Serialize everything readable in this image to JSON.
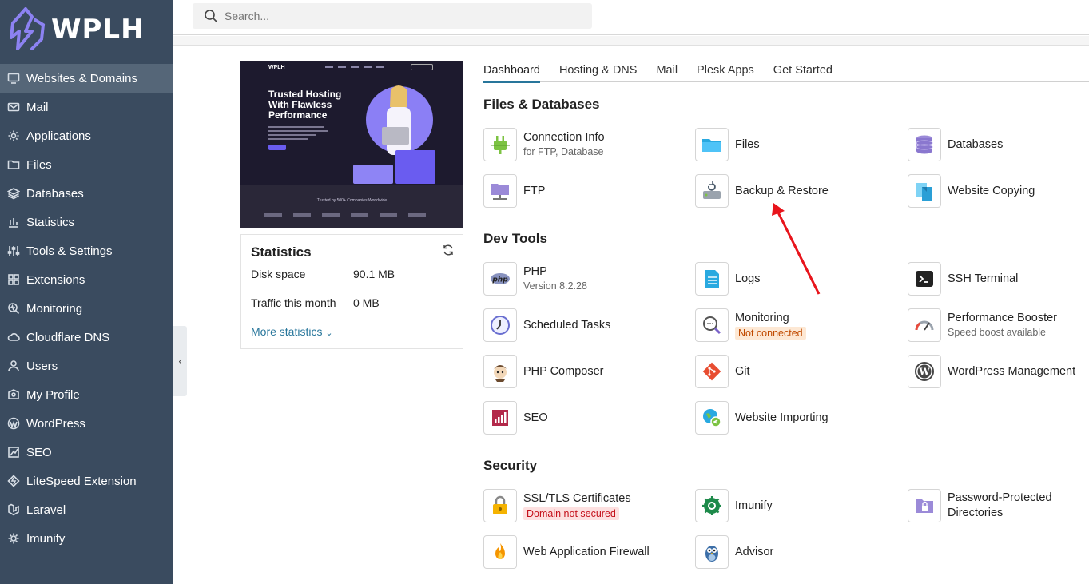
{
  "brand": {
    "logo_text": "WPLH"
  },
  "search": {
    "placeholder": "Search..."
  },
  "sidebar": {
    "items": [
      {
        "label": "Websites & Domains",
        "icon": "monitor-icon",
        "active": true
      },
      {
        "label": "Mail",
        "icon": "mail-icon"
      },
      {
        "label": "Applications",
        "icon": "gear-icon"
      },
      {
        "label": "Files",
        "icon": "folder-icon"
      },
      {
        "label": "Databases",
        "icon": "layers-icon"
      },
      {
        "label": "Statistics",
        "icon": "bar-chart-icon"
      },
      {
        "label": "Tools & Settings",
        "icon": "sliders-icon"
      },
      {
        "label": "Extensions",
        "icon": "grid-icon"
      },
      {
        "label": "Monitoring",
        "icon": "monitoring-icon"
      },
      {
        "label": "Cloudflare DNS",
        "icon": "cloud-icon"
      },
      {
        "label": "Users",
        "icon": "user-icon"
      },
      {
        "label": "My Profile",
        "icon": "profile-icon"
      },
      {
        "label": "WordPress",
        "icon": "wordpress-icon"
      },
      {
        "label": "SEO",
        "icon": "seo-icon"
      },
      {
        "label": "LiteSpeed Extension",
        "icon": "litespeed-icon"
      },
      {
        "label": "Laravel",
        "icon": "laravel-icon"
      },
      {
        "label": "Imunify",
        "icon": "imunify-icon"
      }
    ]
  },
  "preview": {
    "logo": "WPLH",
    "headline": "Trusted Hosting With Flawless Performance",
    "trusted": "Trusted by 500+ Companies Worldwide"
  },
  "stats": {
    "title": "Statistics",
    "disk_label": "Disk space",
    "disk_value": "90.1 MB",
    "traffic_label": "Traffic this month",
    "traffic_value": "0 MB",
    "more": "More statistics"
  },
  "tabs": [
    "Dashboard",
    "Hosting & DNS",
    "Mail",
    "Plesk Apps",
    "Get Started"
  ],
  "sections": {
    "files": "Files & Databases",
    "dev": "Dev Tools",
    "security": "Security"
  },
  "tools": {
    "connection_info": {
      "label": "Connection Info",
      "sub": "for FTP, Database"
    },
    "files": {
      "label": "Files"
    },
    "databases": {
      "label": "Databases"
    },
    "ftp": {
      "label": "FTP"
    },
    "backup": {
      "label": "Backup & Restore"
    },
    "website_copying": {
      "label": "Website Copying"
    },
    "php": {
      "label": "PHP",
      "sub": "Version 8.2.28"
    },
    "logs": {
      "label": "Logs"
    },
    "ssh": {
      "label": "SSH Terminal"
    },
    "scheduled": {
      "label": "Scheduled Tasks"
    },
    "monitoring": {
      "label": "Monitoring",
      "badge": "Not connected"
    },
    "perf": {
      "label": "Performance Booster",
      "sub": "Speed boost available"
    },
    "composer": {
      "label": "PHP Composer"
    },
    "git": {
      "label": "Git"
    },
    "wp": {
      "label": "WordPress Management"
    },
    "seo": {
      "label": "SEO"
    },
    "importing": {
      "label": "Website Importing"
    },
    "ssl": {
      "label": "SSL/TLS Certificates",
      "badge": "Domain not secured"
    },
    "imunify": {
      "label": "Imunify"
    },
    "pwdir": {
      "label": "Password-Protected Directories"
    },
    "waf": {
      "label": "Web Application Firewall"
    },
    "advisor": {
      "label": "Advisor"
    }
  },
  "colors": {
    "sidebar": "#3a4b5f",
    "accent": "#28769b",
    "arrow": "#e8141b"
  }
}
